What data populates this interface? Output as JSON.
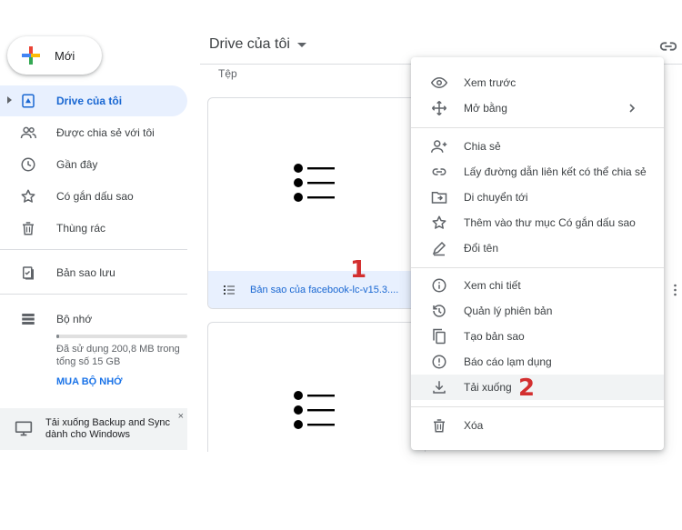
{
  "sidebar": {
    "new_label": "Mới",
    "items": [
      {
        "label": "Drive của tôi",
        "icon": "my-drive-icon"
      },
      {
        "label": "Được chia sẻ với tôi",
        "icon": "people-icon"
      },
      {
        "label": "Gần đây",
        "icon": "clock-icon"
      },
      {
        "label": "Có gắn dấu sao",
        "icon": "star-icon"
      },
      {
        "label": "Thùng rác",
        "icon": "trash-icon"
      },
      {
        "label": "Bản sao lưu",
        "icon": "backup-icon"
      },
      {
        "label": "Bộ nhớ",
        "icon": "storage-icon"
      }
    ],
    "storage": {
      "used_text": "Đã sử dụng 200,8 MB trong tổng số 15 GB",
      "used_fraction": 0.013,
      "buy_label": "MUA BỘ NHỚ"
    },
    "backup_banner": {
      "text": "Tải xuống Backup and Sync dành cho Windows",
      "close": "×"
    }
  },
  "header": {
    "title": "Drive của tôi",
    "files_heading": "Tệp"
  },
  "files": [
    {
      "name": "Bản sao của facebook-lc-v15.3...."
    }
  ],
  "annotations": {
    "marker_1": "1",
    "marker_2": "2"
  },
  "context_menu": {
    "items": [
      {
        "label": "Xem trước",
        "icon": "eye-icon"
      },
      {
        "label": "Mở bằng",
        "icon": "move-arrows-icon"
      },
      {
        "label": "Chia sẻ",
        "icon": "add-person-icon"
      },
      {
        "label": "Lấy đường dẫn liên kết có thể chia sẻ",
        "icon": "link-icon"
      },
      {
        "label": "Di chuyển tới",
        "icon": "folder-move-icon"
      },
      {
        "label": "Thêm vào thư mục Có gắn dấu sao",
        "icon": "star-icon"
      },
      {
        "label": "Đổi tên",
        "icon": "pencil-icon"
      },
      {
        "label": "Xem chi tiết",
        "icon": "info-icon"
      },
      {
        "label": "Quản lý phiên bản",
        "icon": "history-icon"
      },
      {
        "label": "Tạo bản sao",
        "icon": "copy-icon"
      },
      {
        "label": "Báo cáo lạm dụng",
        "icon": "report-icon"
      },
      {
        "label": "Tải xuống",
        "icon": "download-icon"
      },
      {
        "label": "Xóa",
        "icon": "trash-icon"
      }
    ]
  },
  "colors": {
    "accent": "#1a73e8",
    "active_bg": "#e8f0fe",
    "marker": "#d32f2f"
  }
}
